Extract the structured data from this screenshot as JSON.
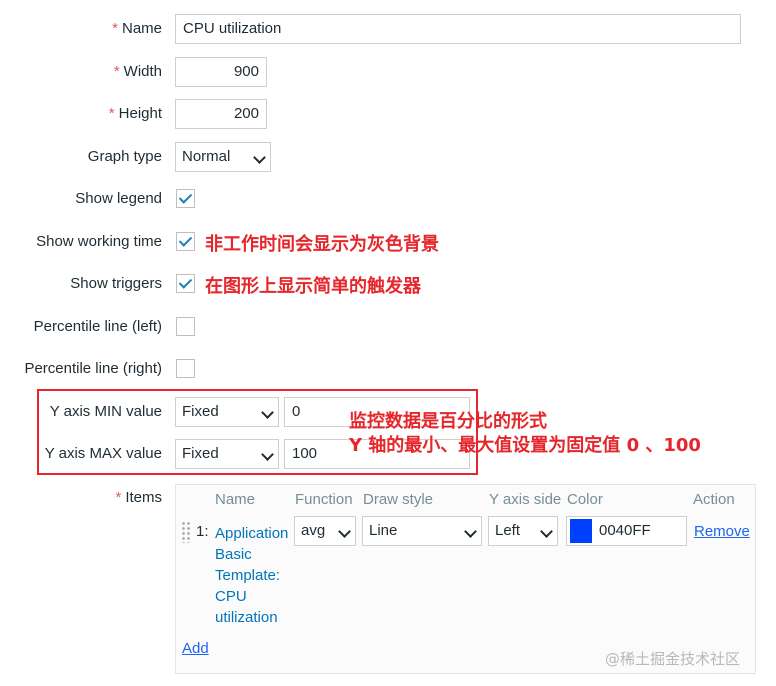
{
  "form": {
    "name_label": "Name",
    "name_value": "CPU utilization",
    "width_label": "Width",
    "width_value": "900",
    "height_label": "Height",
    "height_value": "200",
    "graph_type_label": "Graph type",
    "graph_type_value": "Normal",
    "show_legend_label": "Show legend",
    "show_legend_checked": true,
    "show_working_time_label": "Show working time",
    "show_working_time_checked": true,
    "show_triggers_label": "Show triggers",
    "show_triggers_checked": true,
    "percentile_left_label": "Percentile line (left)",
    "percentile_left_checked": false,
    "percentile_right_label": "Percentile line (right)",
    "percentile_right_checked": false,
    "ymin_label": "Y axis MIN value",
    "ymin_type": "Fixed",
    "ymin_value": "0",
    "ymax_label": "Y axis MAX value",
    "ymax_type": "Fixed",
    "ymax_value": "100",
    "items_label": "Items",
    "required_marker": "*"
  },
  "items_table": {
    "headers": {
      "name": "Name",
      "function": "Function",
      "draw_style": "Draw style",
      "y_axis_side": "Y axis side",
      "color": "Color",
      "action": "Action"
    },
    "rows": [
      {
        "index": "1:",
        "name_lines": [
          "Application",
          "Basic",
          "Template:",
          "CPU",
          "utilization"
        ],
        "function": "avg",
        "draw_style": "Line",
        "y_axis_side": "Left",
        "color": "0040FF",
        "color_hex": "#0040ff",
        "action": "Remove"
      }
    ],
    "add_label": "Add"
  },
  "annotations": {
    "working_time": "非工作时间会显示为灰色背景",
    "triggers": "在图形上显示简单的触发器",
    "yaxis_line1": "监控数据是百分比的形式",
    "yaxis_line2": "Y 轴的最小、最大值设置为固定值 0 、100"
  },
  "watermark": "@稀土掘金技术社区",
  "colors": {
    "annotation": "#e5262b",
    "required": "#e45959",
    "link": "#1f65f4",
    "checkbox_tick": "#1f7fb6"
  }
}
